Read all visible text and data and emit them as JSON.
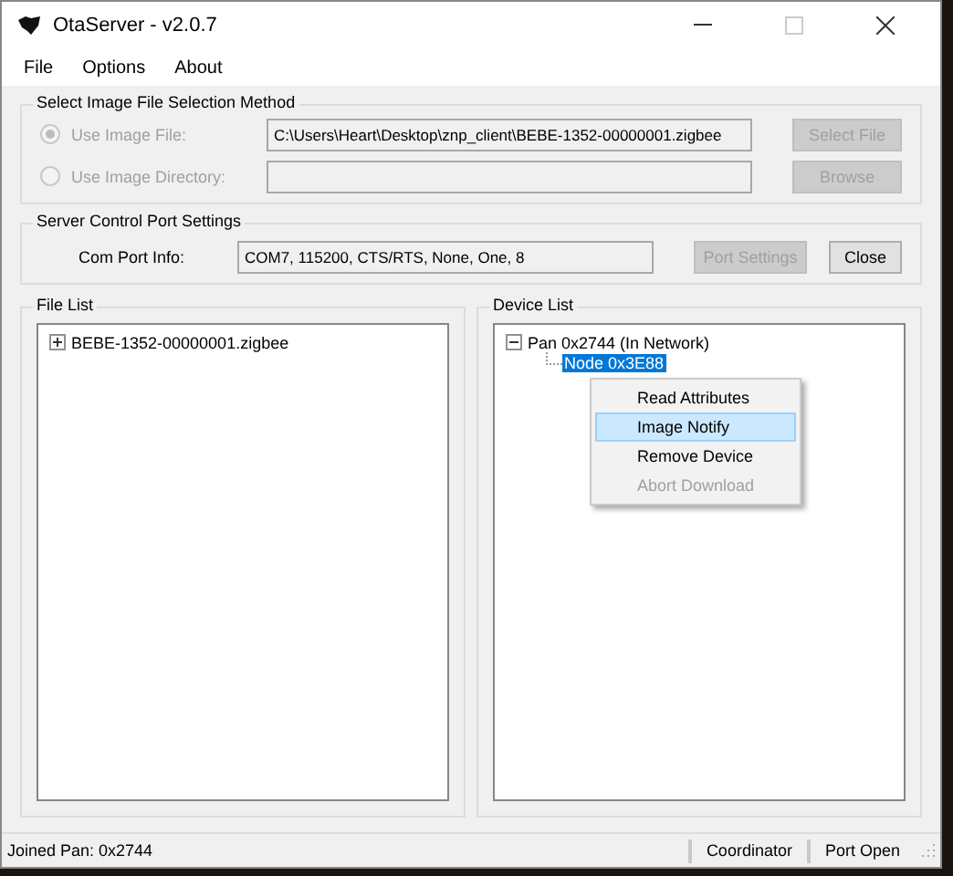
{
  "window": {
    "title": "OtaServer - v2.0.7"
  },
  "menu": [
    "File",
    "Options",
    "About"
  ],
  "image_selection": {
    "title": "Select Image File Selection Method",
    "options": [
      {
        "label": "Use Image File:",
        "selected": true,
        "disabled": true,
        "value": "C:\\Users\\Heart\\Desktop\\znp_client\\BEBE-1352-00000001.zigbee",
        "button": {
          "label": "Select File",
          "disabled": true
        }
      },
      {
        "label": "Use Image Directory:",
        "selected": false,
        "disabled": true,
        "button": {
          "label": "Browse",
          "disabled": true
        }
      }
    ]
  },
  "port_settings": {
    "title": "Server Control Port Settings",
    "label": "Com Port Info:",
    "value": "COM7, 115200, CTS/RTS, None, One, 8",
    "buttons": [
      {
        "label": "Port Settings",
        "disabled": true
      },
      {
        "label": "Close",
        "disabled": false
      }
    ]
  },
  "file_list": {
    "title": "File List",
    "items": [
      {
        "label": "BEBE-1352-00000001.zigbee",
        "expanded": false,
        "selected": false
      }
    ]
  },
  "device_list": {
    "title": "Device List",
    "items": [
      {
        "label": "Pan 0x2744 (In Network)",
        "expanded": true,
        "selected": false,
        "children": [
          {
            "label": "Node 0x3E88",
            "selected": true
          }
        ]
      }
    ]
  },
  "context_menu": [
    {
      "label": "Read Attributes",
      "selected": false,
      "disabled": false
    },
    {
      "label": "Image Notify",
      "selected": true,
      "disabled": false
    },
    {
      "label": "Remove Device",
      "selected": false,
      "disabled": false
    },
    {
      "label": "Abort Download",
      "selected": false,
      "disabled": true
    }
  ],
  "status_bar": {
    "text": "Joined Pan: 0x2744",
    "panels": [
      "Coordinator",
      "Port Open"
    ]
  }
}
